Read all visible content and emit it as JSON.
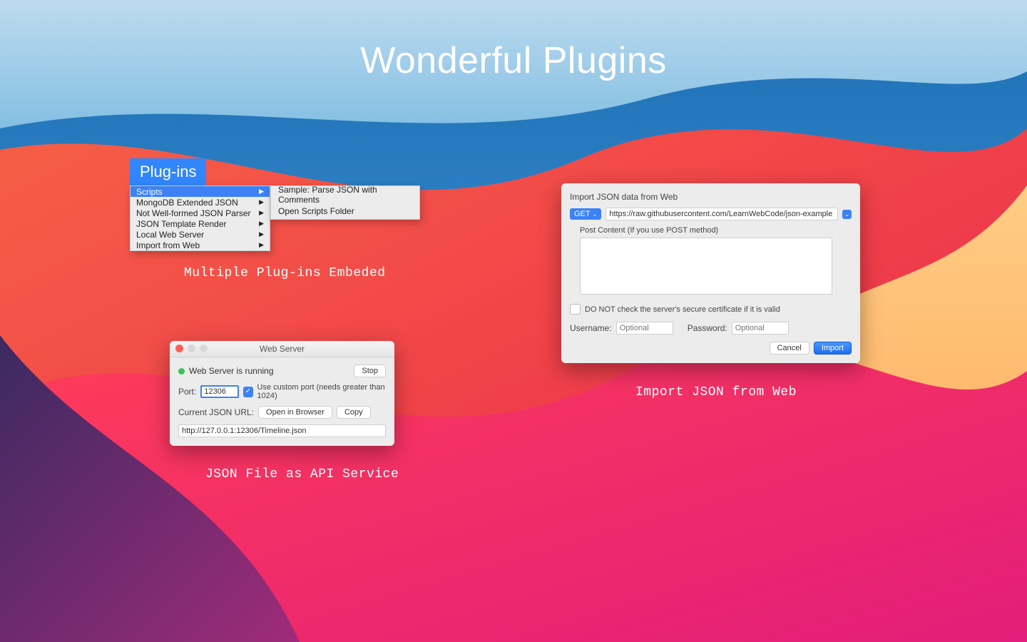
{
  "title": "Wonderful Plugins",
  "captions": {
    "plugins": "Multiple Plug-ins Embeded",
    "webserver": "JSON File as API Service",
    "importweb": "Import JSON from Web"
  },
  "menu": {
    "title": "Plug-ins",
    "items": [
      {
        "label": "Scripts",
        "hl": true
      },
      {
        "label": "MongoDB Extended JSON"
      },
      {
        "label": "Not Well-formed JSON Parser"
      },
      {
        "label": "JSON Template Render"
      },
      {
        "label": "Local Web Server"
      },
      {
        "label": "Import from Web"
      }
    ],
    "submenu": [
      "Sample: Parse JSON with Comments",
      "Open Scripts Folder"
    ]
  },
  "webserver": {
    "window_title": "Web Server",
    "status": "Web Server is running",
    "stop": "Stop",
    "port_label": "Port:",
    "port_value": "12306",
    "custom_port": "Use custom port (needs greater than 1024)",
    "url_label": "Current JSON URL:",
    "open_browser": "Open in Browser",
    "copy": "Copy",
    "url_value": "http://127.0.0.1:12306/Timeline.json"
  },
  "importweb": {
    "header": "Import JSON data from Web",
    "method": "GET",
    "url": "https://raw.githubusercontent.com/LearnWebCode/json-example",
    "post_label": "Post Content (If you use POST method)",
    "cert_label": "DO NOT check the server's secure certificate if it is valid",
    "username_label": "Username:",
    "password_label": "Password:",
    "placeholder": "Optional",
    "cancel": "Cancel",
    "import": "Import"
  }
}
